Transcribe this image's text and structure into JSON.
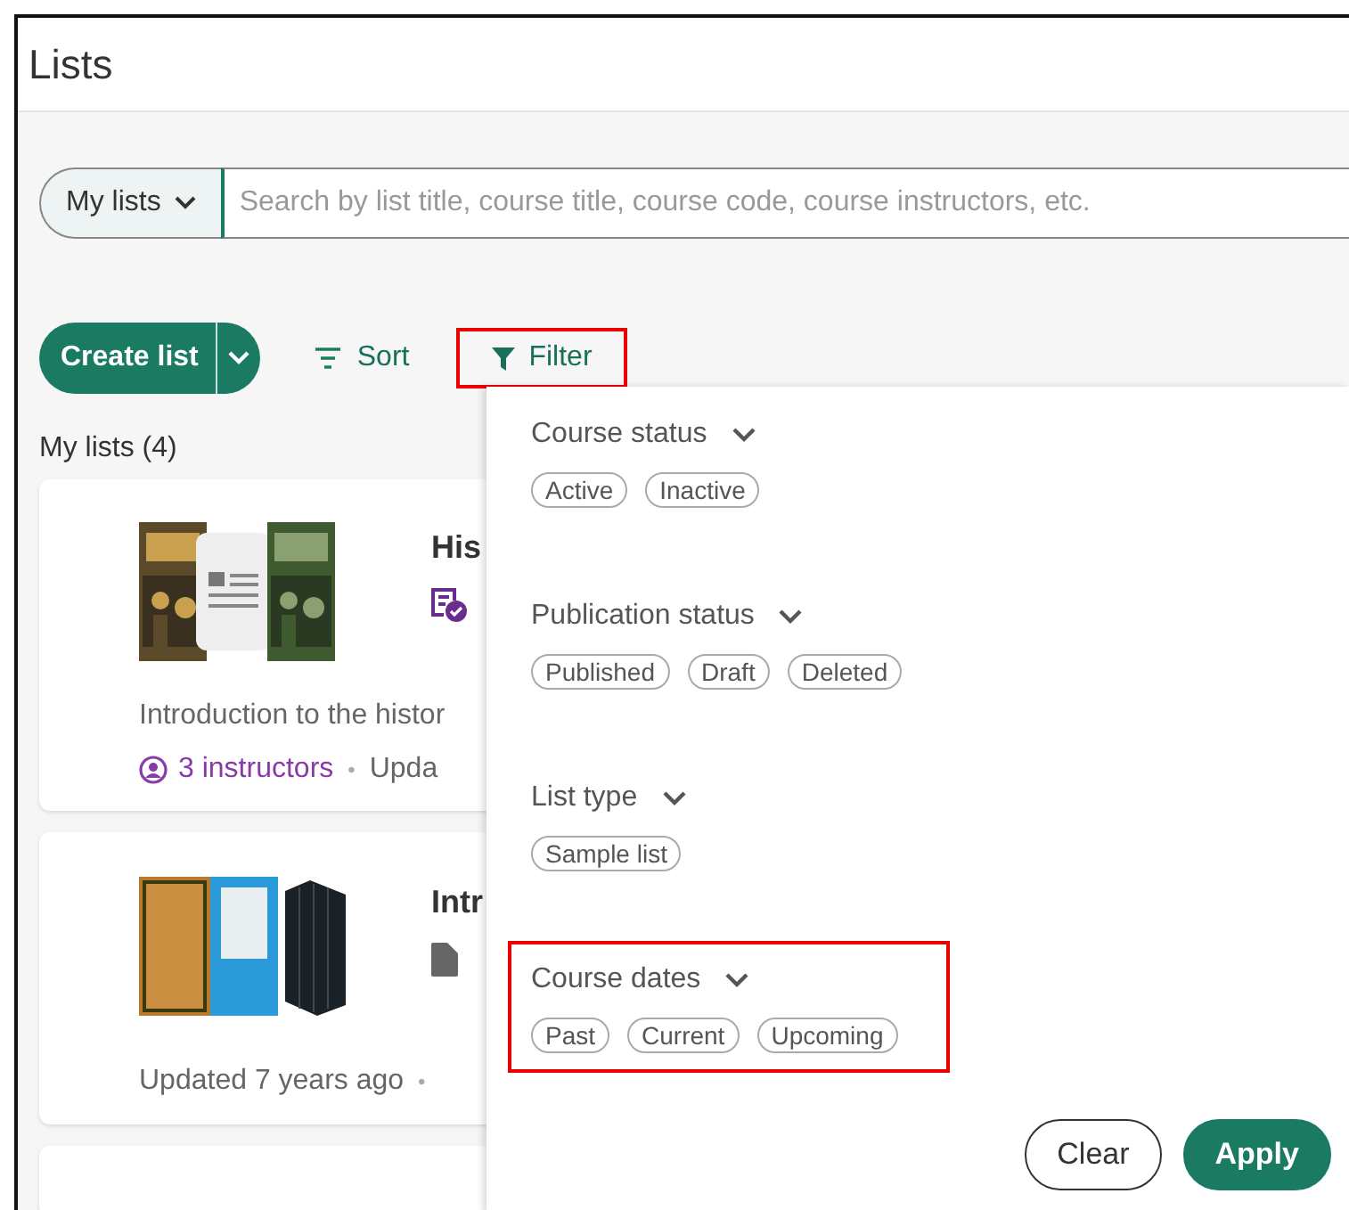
{
  "header": {
    "title": "Lists"
  },
  "search": {
    "scope": "My lists",
    "placeholder": "Search by list title, course title, course code, course instructors, etc."
  },
  "toolbar": {
    "create": "Create list",
    "sort": "Sort",
    "filter": {
      "label": "Filter",
      "highlighted": true
    }
  },
  "section_title": "My lists (4)",
  "cards": [
    {
      "title": "His",
      "description": "Introduction to the histor",
      "instructors": "3 instructors",
      "separator": "•",
      "updated": "Upda"
    },
    {
      "title": "Intr",
      "updated": "Updated 7 years ago",
      "separator": "•"
    }
  ],
  "filter_panel": {
    "sections": [
      {
        "title": "Course status",
        "highlighted": false,
        "chips": [
          {
            "label": "Active",
            "selected": false
          },
          {
            "label": "Inactive",
            "selected": false
          }
        ]
      },
      {
        "title": "Publication status",
        "highlighted": false,
        "chips": [
          {
            "label": "Published",
            "selected": false
          },
          {
            "label": "Draft",
            "selected": false
          },
          {
            "label": "Deleted",
            "selected": false
          }
        ]
      },
      {
        "title": "List type",
        "highlighted": false,
        "chips": [
          {
            "label": "Sample list",
            "selected": false
          }
        ]
      },
      {
        "title": "Course dates",
        "highlighted": true,
        "chips": [
          {
            "label": "Past",
            "selected": false
          },
          {
            "label": "Current",
            "selected": false
          },
          {
            "label": "Upcoming",
            "selected": false
          }
        ]
      }
    ],
    "buttons": [
      {
        "label": "Clear",
        "kind": "secondary"
      },
      {
        "label": "Apply",
        "kind": "primary"
      }
    ]
  }
}
